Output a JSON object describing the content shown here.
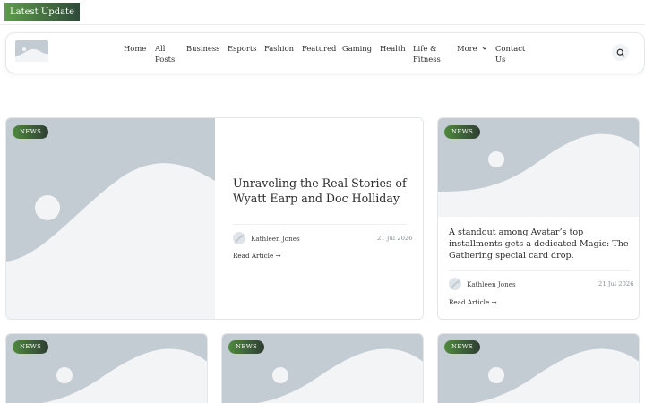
{
  "topbar": {
    "latest_label": "Latest  Update"
  },
  "nav": {
    "items": [
      {
        "label": "Home",
        "active": true
      },
      {
        "label": "All\nPosts"
      },
      {
        "label": "Business"
      },
      {
        "label": "Esports"
      },
      {
        "label": "Fashion"
      },
      {
        "label": "Featured"
      },
      {
        "label": "Gaming"
      },
      {
        "label": "Health"
      },
      {
        "label": "Life &\nFitness"
      },
      {
        "label": "More"
      },
      {
        "label": "Contact\nUs"
      }
    ]
  },
  "featured": {
    "badge": "NEWS",
    "title": "Unraveling the Real Stories of Wyatt Earp and Doc Holliday",
    "author": "Kathleen Jones",
    "date": "21 Jul 2026",
    "read_label": "Read Article  →"
  },
  "side_card": {
    "badge": "NEWS",
    "title": "A standout among Avatar’s top installments gets a dedicated Magic: The Gathering special card drop.",
    "author": "Kathleen Jones",
    "date": "21 Jul 2026",
    "read_label": "Read Article  →"
  },
  "bottom_cards": [
    {
      "badge": "NEWS"
    },
    {
      "badge": "NEWS"
    },
    {
      "badge": "NEWS"
    }
  ],
  "colors": {
    "accent_green": "#4f8a3e",
    "placeholder_bg": "#c3cbd3",
    "placeholder_fg": "#f3f4f6"
  }
}
